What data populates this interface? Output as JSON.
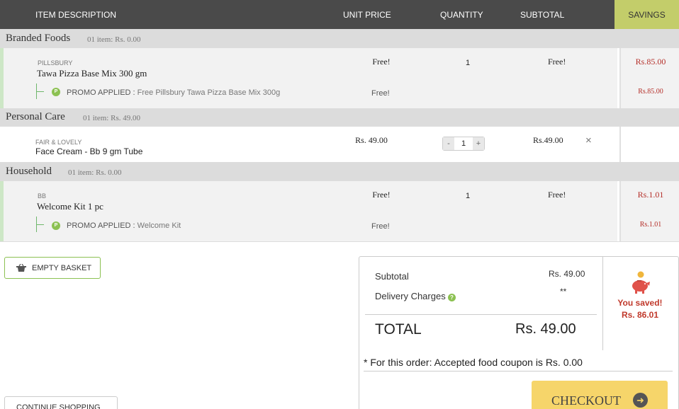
{
  "header": {
    "item_description": "ITEM DESCRIPTION",
    "unit_price": "UNIT PRICE",
    "quantity": "QUANTITY",
    "subtotal": "SUBTOTAL",
    "savings": "SAVINGS"
  },
  "categories": [
    {
      "name": "Branded Foods",
      "count": "01 item: Rs. 0.00",
      "item": {
        "brand": "PILLSBURY",
        "name": "Tawa Pizza Base Mix 300 gm",
        "unit_price": "Free!",
        "quantity": "1",
        "subtotal": "Free!",
        "savings": "Rs.85.00",
        "promo_label": "PROMO APPLIED :",
        "promo_text": "Free Pillsbury Tawa Pizza Base Mix 300g",
        "promo_price": "Free!",
        "promo_savings": "Rs.85.00"
      }
    },
    {
      "name": "Personal Care",
      "count": "01 item: Rs. 49.00",
      "item": {
        "brand": "FAIR & LOVELY",
        "name": "Face Cream - Bb 9 gm Tube",
        "unit_price": "Rs. 49.00",
        "quantity": "1",
        "subtotal": "Rs.49.00",
        "minus": "-",
        "plus": "+",
        "remove": "×"
      }
    },
    {
      "name": "Household",
      "count": "01 item: Rs. 0.00",
      "item": {
        "brand": "BB",
        "name": "Welcome Kit 1 pc",
        "unit_price": "Free!",
        "quantity": "1",
        "subtotal": "Free!",
        "savings": "Rs.1.01",
        "promo_label": "PROMO APPLIED :",
        "promo_text": "Welcome Kit",
        "promo_price": "Free!",
        "promo_savings": "Rs.1.01"
      }
    }
  ],
  "buttons": {
    "empty_basket": "EMPTY BASKET",
    "continue_shopping": "CONTINUE SHOPPING",
    "checkout": "CHECKOUT"
  },
  "summary": {
    "subtotal_label": "Subtotal",
    "subtotal_value": "Rs. 49.00",
    "delivery_label": "Delivery Charges",
    "delivery_value": "**",
    "total_label": "TOTAL",
    "total_value": "Rs. 49.00",
    "saved_label": "You saved!",
    "saved_value": "Rs. 86.01",
    "coupon_note": "* For this order: Accepted food coupon is Rs. 0.00"
  },
  "icons": {
    "promo_badge": "P",
    "help": "?",
    "checkout_arrow": "➜"
  },
  "colors": {
    "header_bg": "#4a4a4a",
    "savings_header_bg": "#c3cd6a",
    "savings_text": "#b5302a",
    "accent_green": "#8cc152",
    "checkout_bg": "#f6d56a"
  }
}
